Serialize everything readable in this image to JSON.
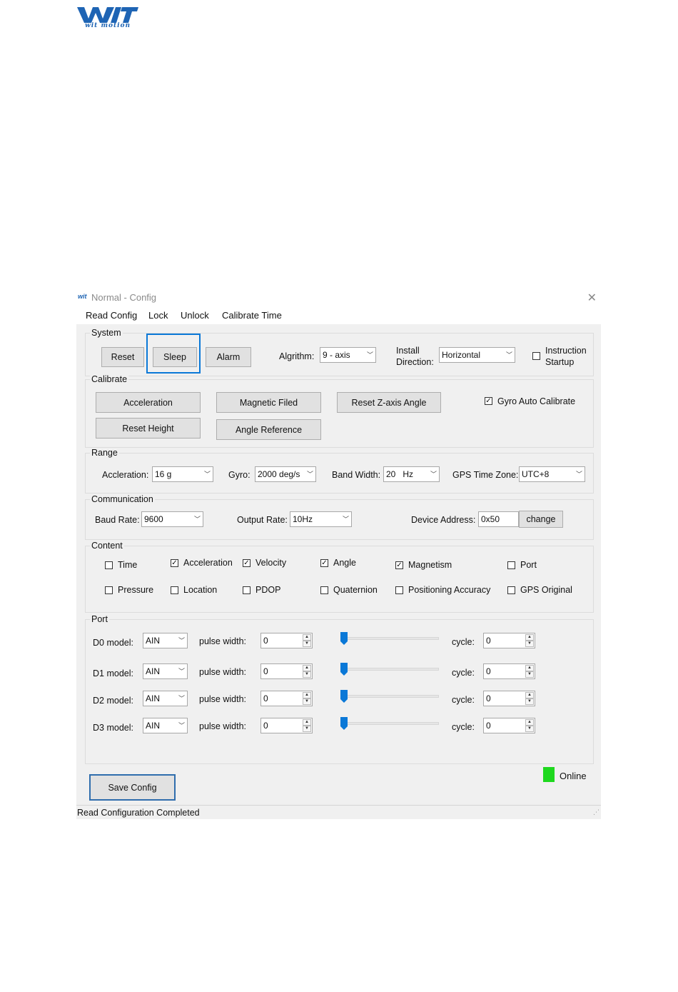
{
  "app": {
    "logo_text": "wit motion",
    "window_title": "Normal - Config"
  },
  "menu": [
    "Read Config",
    "Lock",
    "Unlock",
    "Calibrate Time"
  ],
  "system": {
    "title": "System",
    "reset": "Reset",
    "sleep": "Sleep",
    "alarm": "Alarm",
    "algorithm_label": "Algrithm:",
    "algorithm_value": "9 - axis",
    "install_label_1": "Install",
    "install_label_2": "Direction:",
    "install_value": "Horizontal",
    "instruction_label_1": "Instruction",
    "instruction_label_2": "Startup"
  },
  "calibrate": {
    "title": "Calibrate",
    "acceleration": "Acceleration",
    "magnetic": "Magnetic Filed",
    "reset_z": "Reset Z-axis Angle",
    "gyro_auto": "Gyro Auto Calibrate",
    "reset_height": "Reset Height",
    "angle_reference": "Angle Reference"
  },
  "range": {
    "title": "Range",
    "accel_label": "Accleration:",
    "accel_value": "16 g",
    "gyro_label": "Gyro:",
    "gyro_value": "2000 deg/s",
    "band_label": "Band Width:",
    "band_value": "20   Hz",
    "gps_label": "GPS Time Zone:",
    "gps_value": "UTC+8"
  },
  "communication": {
    "title": "Communication",
    "baud_label": "Baud Rate:",
    "baud_value": "9600",
    "output_label": "Output Rate:",
    "output_value": "10Hz",
    "device_label": "Device Address:",
    "device_value": "0x50",
    "change": "change"
  },
  "content": {
    "title": "Content",
    "items": [
      {
        "label": "Time",
        "checked": false
      },
      {
        "label": "Acceleration",
        "checked": true
      },
      {
        "label": "Velocity",
        "checked": true
      },
      {
        "label": "Angle",
        "checked": true
      },
      {
        "label": "Magnetism",
        "checked": true
      },
      {
        "label": "Port",
        "checked": false
      },
      {
        "label": "Pressure",
        "checked": false
      },
      {
        "label": "Location",
        "checked": false
      },
      {
        "label": "PDOP",
        "checked": false
      },
      {
        "label": "Quaternion",
        "checked": false
      },
      {
        "label": "Positioning Accuracy",
        "checked": false
      },
      {
        "label": "GPS Original",
        "checked": false
      }
    ]
  },
  "port": {
    "title": "Port",
    "pulse_label": "pulse width:",
    "cycle_label": "cycle:",
    "rows": [
      {
        "label": "D0 model:",
        "mode": "AIN",
        "pulse": "0",
        "cycle": "0",
        "slider": 0
      },
      {
        "label": "D1 model:",
        "mode": "AIN",
        "pulse": "0",
        "cycle": "0",
        "slider": 0
      },
      {
        "label": "D2 model:",
        "mode": "AIN",
        "pulse": "0",
        "cycle": "0",
        "slider": 0
      },
      {
        "label": "D3 model:",
        "mode": "AIN",
        "pulse": "0",
        "cycle": "0",
        "slider": 0
      }
    ]
  },
  "footer": {
    "save": "Save Config",
    "online": "Online",
    "online_color": "#1ed81e",
    "status": "Read Configuration Completed"
  },
  "colors": {
    "accent": "#0a78d7",
    "brand": "#1e64b4"
  }
}
